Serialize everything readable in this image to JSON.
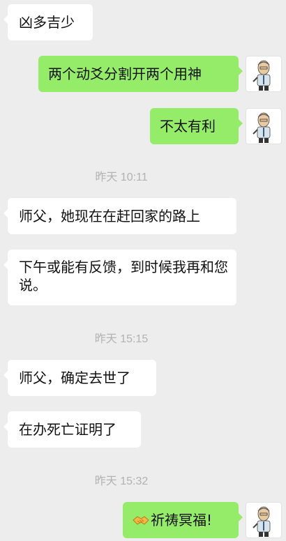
{
  "messages": [
    {
      "text": "凶多吉少"
    },
    {
      "text": "两个动爻分割开两个用神"
    },
    {
      "text": "不太有利"
    },
    {
      "text": "师父，她现在在赶回家的路上"
    },
    {
      "text": "下午或能有反馈，到时候我再和您说。"
    },
    {
      "text": "师父，确定去世了"
    },
    {
      "text": "在办死亡证明了"
    },
    {
      "text": "祈祷冥福!",
      "emoji": "handshake-emoji"
    }
  ],
  "timestamps": [
    "昨天 10:11",
    "昨天 15:15",
    "昨天 15:32"
  ],
  "colors": {
    "background": "#ededed",
    "bubble_incoming": "#ffffff",
    "bubble_outgoing": "#95ec69",
    "timestamp_text": "#b2b2b2"
  }
}
